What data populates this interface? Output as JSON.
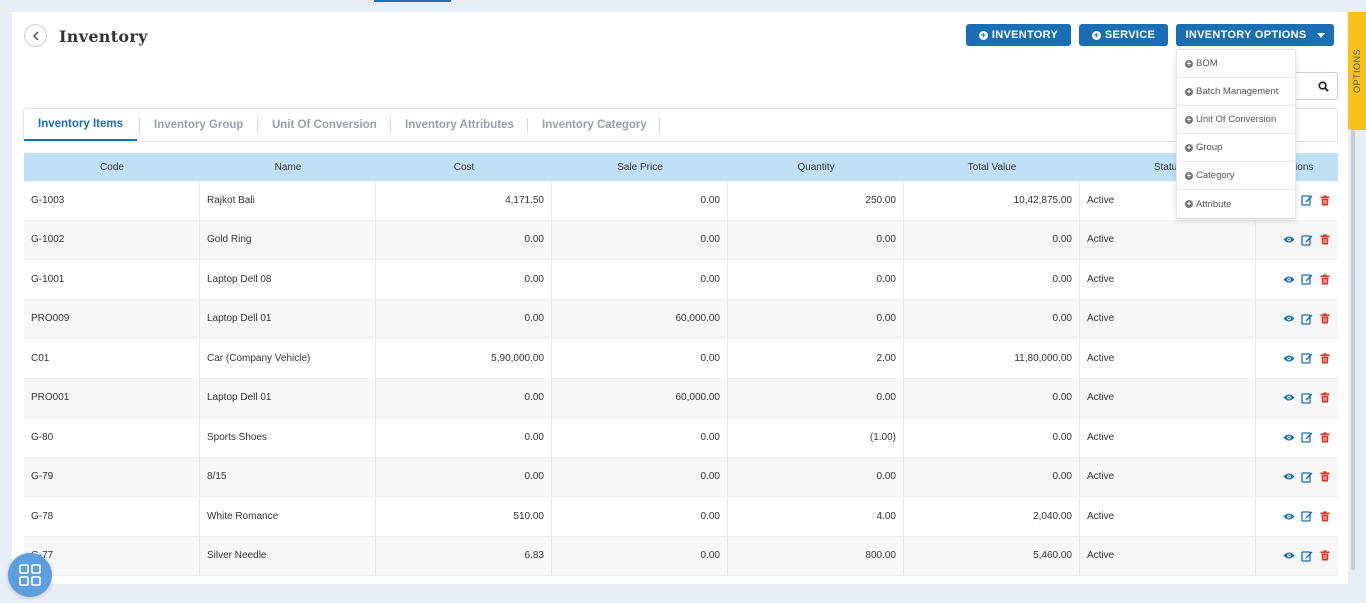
{
  "header": {
    "title": "Inventory"
  },
  "actions": {
    "inventory_label": "INVENTORY",
    "service_label": "SERVICE",
    "options_label": "INVENTORY OPTIONS"
  },
  "options_dropdown": [
    {
      "label": "BOM"
    },
    {
      "label": "Batch Management"
    },
    {
      "label": "Unit Of Conversion"
    },
    {
      "label": "Group"
    },
    {
      "label": "Category"
    },
    {
      "label": "Attribute"
    }
  ],
  "side_tab": {
    "label": "OPTIONS"
  },
  "tabs": [
    {
      "label": "Inventory Items",
      "active": true
    },
    {
      "label": "Inventory Group"
    },
    {
      "label": "Unit Of Conversion"
    },
    {
      "label": "Inventory Attributes"
    },
    {
      "label": "Inventory Category"
    }
  ],
  "table": {
    "columns": [
      "Code",
      "Name",
      "Cost",
      "Sale Price",
      "Quantity",
      "Total Value",
      "Status",
      "Actions"
    ],
    "rows": [
      {
        "code": "G-1003",
        "name": "Rajkot Bali",
        "cost": "4,171.50",
        "sale_price": "0.00",
        "quantity": "250.00",
        "total": "10,42,875.00",
        "status": "Active"
      },
      {
        "code": "G-1002",
        "name": "Gold Ring",
        "cost": "0.00",
        "sale_price": "0.00",
        "quantity": "0.00",
        "total": "0.00",
        "status": "Active"
      },
      {
        "code": "G-1001",
        "name": "Laptop Dell 08",
        "cost": "0.00",
        "sale_price": "0.00",
        "quantity": "0.00",
        "total": "0.00",
        "status": "Active"
      },
      {
        "code": "PRO009",
        "name": "Laptop Dell 01",
        "cost": "0.00",
        "sale_price": "60,000.00",
        "quantity": "0.00",
        "total": "0.00",
        "status": "Active"
      },
      {
        "code": "C01",
        "name": "Car (Company Vehicle)",
        "cost": "5,90,000.00",
        "sale_price": "0.00",
        "quantity": "2.00",
        "total": "11,80,000.00",
        "status": "Active"
      },
      {
        "code": "PRO001",
        "name": "Laptop Dell 01",
        "cost": "0.00",
        "sale_price": "60,000.00",
        "quantity": "0.00",
        "total": "0.00",
        "status": "Active"
      },
      {
        "code": "G-80",
        "name": "Sports Shoes",
        "cost": "0.00",
        "sale_price": "0.00",
        "quantity": "(1.00)",
        "total": "0.00",
        "status": "Active"
      },
      {
        "code": "G-79",
        "name": "8/15",
        "cost": "0.00",
        "sale_price": "0.00",
        "quantity": "0.00",
        "total": "0.00",
        "status": "Active"
      },
      {
        "code": "G-78",
        "name": "White Romance",
        "cost": "510.00",
        "sale_price": "0.00",
        "quantity": "4.00",
        "total": "2,040.00",
        "status": "Active"
      },
      {
        "code": "G-77",
        "name": "Silver Needle",
        "cost": "6.83",
        "sale_price": "0.00",
        "quantity": "800.00",
        "total": "5,460.00",
        "status": "Active"
      }
    ]
  },
  "colors": {
    "primary": "#1a6fb4",
    "header_bg": "#bfe0f7",
    "side_tab": "#f6c21a",
    "delete": "#d9352b",
    "fab": "#5b9fe0"
  }
}
